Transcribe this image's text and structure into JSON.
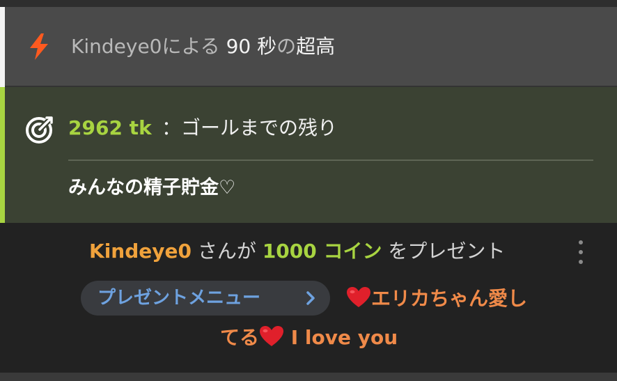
{
  "boost": {
    "icon": "lightning-bolt-icon",
    "icon_color": "#ff5a1f",
    "user": "Kindeye0",
    "by": "による",
    "duration": "90",
    "unit": "秒",
    "particle": "の",
    "label": "超高"
  },
  "goal": {
    "icon": "target-goal-icon",
    "accent_color": "#a8d441",
    "amount": "2962 tk",
    "remaining_label": "：ゴールまでの残り",
    "title": "みんなの精子貯金♡"
  },
  "chat": {
    "gift": {
      "user": "Kindeye0",
      "san_ga": "さんが",
      "coins": "1000 コイン",
      "suffix": "をプレゼント"
    },
    "more_icon": "kebab-more-icon",
    "gift_menu_label": "プレゼントメニュー",
    "gift_menu_icon": "chevron-right-icon",
    "message": {
      "heart_icon": "red-heart-emoji",
      "part1": "エリカちゃん愛し",
      "part2": "てる",
      "part3": "I love you"
    }
  }
}
